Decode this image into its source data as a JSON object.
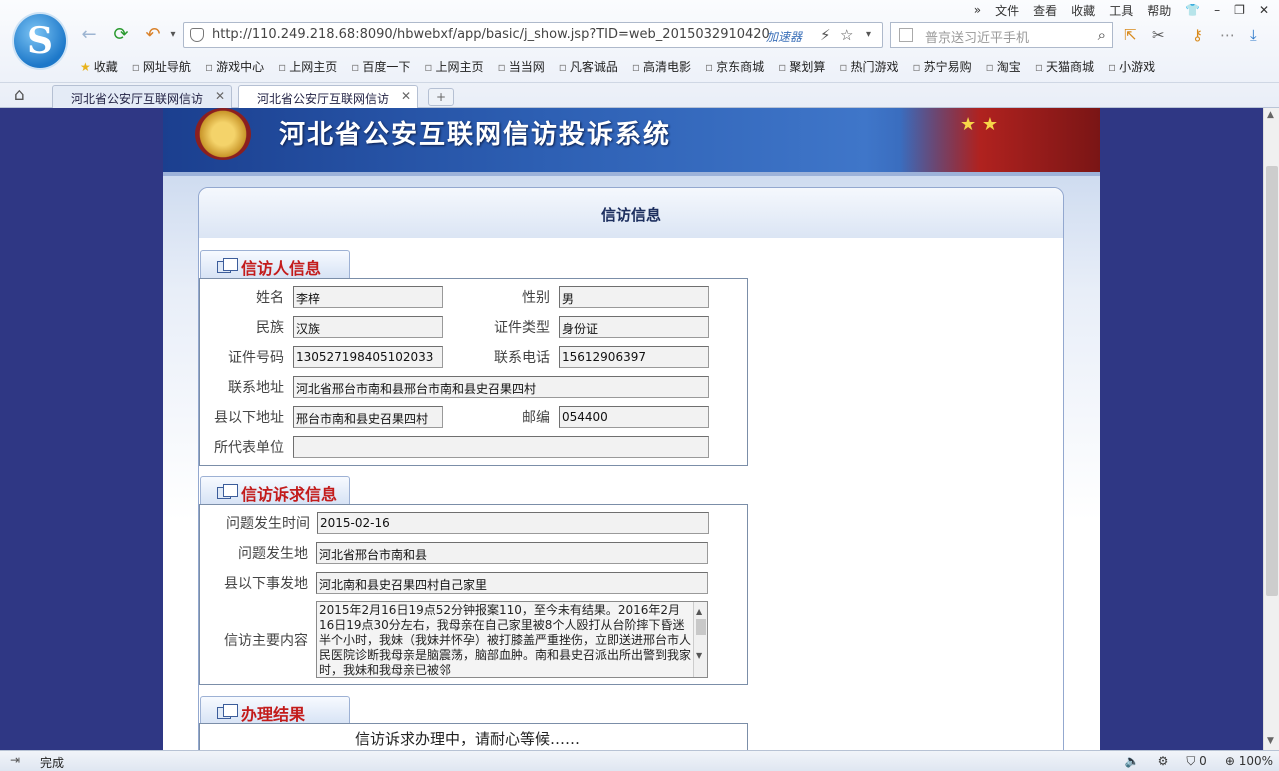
{
  "browser": {
    "menu": [
      "文件",
      "查看",
      "收藏",
      "工具",
      "帮助"
    ],
    "url": "http://110.249.218.68:8090/hbwebxf/app/basic/j_show.jsp?TID=web_2015032910420",
    "accelerator": "加速器",
    "search_placeholder": "普京送习近平手机",
    "bookmarks": [
      "收藏",
      "网址导航",
      "游戏中心",
      "上网主页",
      "百度一下",
      "上网主页",
      "当当网",
      "凡客诚品",
      "高清电影",
      "京东商城",
      "聚划算",
      "热门游戏",
      "苏宁易购",
      "淘宝",
      "天猫商城",
      "小游戏"
    ],
    "tabs": [
      {
        "label": "河北省公安厅互联网信访"
      },
      {
        "label": "河北省公安厅互联网信访"
      }
    ],
    "status_text": "完成",
    "status_right": {
      "count": "0",
      "zoom": "100%"
    },
    "icons": {
      "back": "arrow-left-icon",
      "refresh": "refresh-icon",
      "undo": "undo-icon",
      "home": "home-icon",
      "star": "star-icon",
      "search": "search-icon"
    }
  },
  "site": {
    "banner_title": "河北省公安互联网信访投诉系统",
    "panel_title": "信访信息",
    "colors": {
      "page_bg": "#2f3784",
      "section_title": "#c31b1b",
      "banner": "#2d5fb3"
    }
  },
  "petitioner": {
    "section_title": "信访人信息",
    "name_label": "姓名",
    "name": "李梓",
    "gender_label": "性别",
    "gender": "男",
    "ethnicity_label": "民族",
    "ethnicity": "汉族",
    "id_type_label": "证件类型",
    "id_type": "身份证",
    "id_number_label": "证件号码",
    "id_number": "130527198405102033",
    "phone_label": "联系电话",
    "phone": "15612906397",
    "address_label": "联系地址",
    "address": "河北省邢台市南和县邢台市南和县史召果四村",
    "county_address_label": "县以下地址",
    "county_address": "邢台市南和县史召果四村",
    "postcode_label": "邮编",
    "postcode": "054400",
    "represented_unit_label": "所代表单位",
    "represented_unit": ""
  },
  "complaint": {
    "section_title": "信访诉求信息",
    "time_label": "问题发生时间",
    "time": "2015-02-16",
    "place_label": "问题发生地",
    "place": "河北省邢台市南和县",
    "county_place_label": "县以下事发地",
    "county_place": "河北南和县史召果四村自己家里",
    "content_label": "信访主要内容",
    "content": "2015年2月16日19点52分钟报案110，至今未有结果。2016年2月16日19点30分左右，我母亲在自己家里被8个人殴打从台阶摔下昏迷半个小时，我妹（我妹并怀孕）被打膝盖严重挫伤，立即送进邢台市人民医院诊断我母亲是脑震荡，脑部血肿。南和县史召派出所出警到我家时，我妹和我母亲已被邻"
  },
  "result": {
    "section_title": "办理结果",
    "text": "信访诉求办理中，请耐心等候……"
  }
}
